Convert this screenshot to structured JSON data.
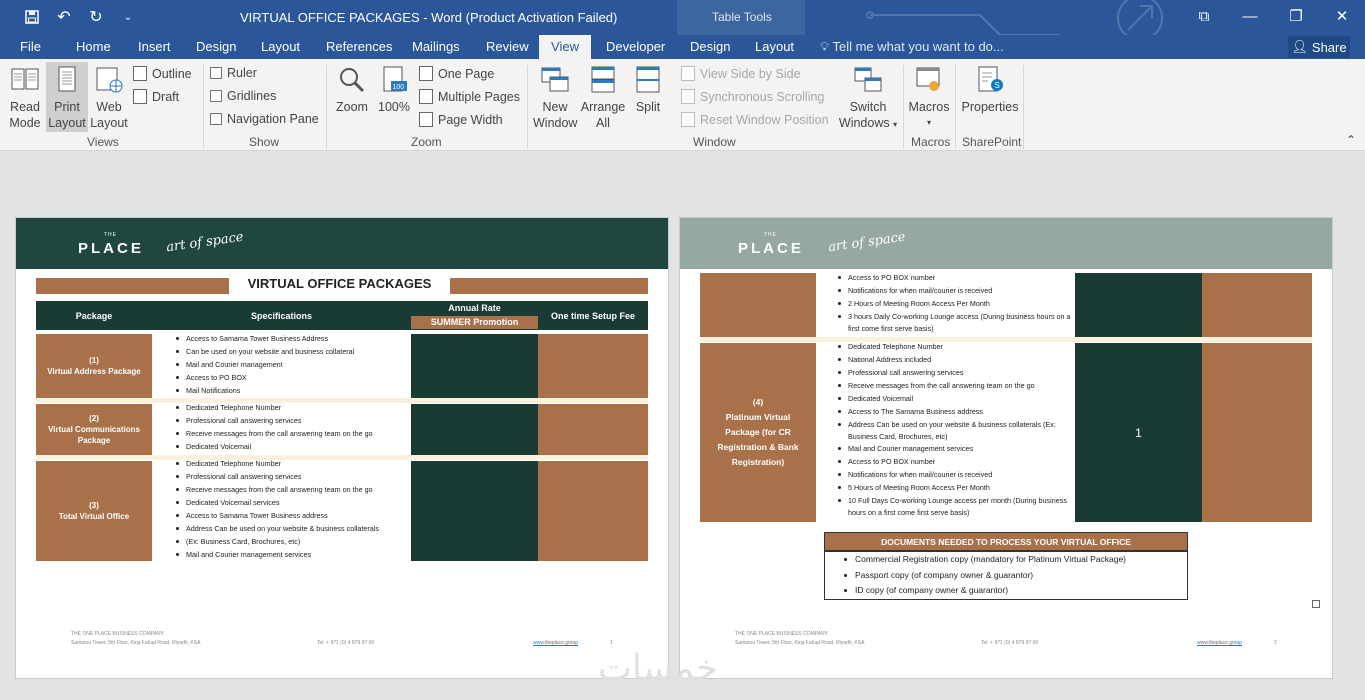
{
  "window": {
    "title": "VIRTUAL OFFICE PACKAGES - Word (Product Activation Failed)",
    "contextual_tab_group": "Table Tools"
  },
  "quick_access": {
    "save_icon": "save-icon",
    "undo_icon": "undo-icon",
    "redo_icon": "redo-icon",
    "customize_icon": "customize-qat-icon"
  },
  "tabs": [
    {
      "label": "File"
    },
    {
      "label": "Home"
    },
    {
      "label": "Insert"
    },
    {
      "label": "Design"
    },
    {
      "label": "Layout"
    },
    {
      "label": "References"
    },
    {
      "label": "Mailings"
    },
    {
      "label": "Review"
    },
    {
      "label": "View",
      "active": true
    },
    {
      "label": "Developer"
    },
    {
      "label": "Design"
    },
    {
      "label": "Layout"
    }
  ],
  "tell_me": "Tell me what you want to do...",
  "share": "Share",
  "ribbon": {
    "views": {
      "read_mode": "Read Mode",
      "print_layout": "Print Layout",
      "web_layout": "Web Layout",
      "outline": "Outline",
      "draft": "Draft",
      "group": "Views",
      "read_1": "Read",
      "read_2": "Mode",
      "print_1": "Print",
      "print_2": "Layout",
      "web_1": "Web",
      "web_2": "Layout"
    },
    "show": {
      "ruler": "Ruler",
      "gridlines": "Gridlines",
      "navigation_pane": "Navigation Pane",
      "group": "Show"
    },
    "zoom": {
      "zoom": "Zoom",
      "hundred": "100%",
      "one_page": "One Page",
      "multiple_pages": "Multiple Pages",
      "page_width": "Page Width",
      "group": "Zoom",
      "hundred_icon_text": "100"
    },
    "window": {
      "new_1": "New",
      "new_2": "Window",
      "arrange_1": "Arrange",
      "arrange_2": "All",
      "split": "Split",
      "view_side_by_side": "View Side by Side",
      "sync_scrolling": "Synchronous Scrolling",
      "reset_position": "Reset Window Position",
      "switch_1": "Switch",
      "switch_2": "Windows",
      "group": "Window"
    },
    "macros": {
      "macros": "Macros",
      "group": "Macros"
    },
    "sharepoint": {
      "properties": "Properties",
      "group": "SharePoint"
    }
  },
  "page1": {
    "logo_the": "THE",
    "logo": "PLACE",
    "tagline": "art of space",
    "title": "VIRTUAL OFFICE PACKAGES",
    "headers": {
      "package": "Package",
      "specifications": "Specifications",
      "annual_rate": "Annual Rate",
      "summer": "SUMMER Promotion",
      "setup": "One time Setup Fee"
    },
    "packages": [
      {
        "num": "(1)",
        "name": "Virtual Address Package",
        "specs": [
          "Access to Samama Tower Business Address",
          "Can be used on your website and business collateral",
          "Mail and Courier management",
          "Access to PO BOX",
          "Mail Notifications"
        ]
      },
      {
        "num": "(2)",
        "name": "Virtual Communications Package",
        "specs": [
          "Dedicated Telephone Number",
          "Professional call answering services",
          "Receive messages from the call answering team on the go",
          "Dedicated Voicemail"
        ]
      },
      {
        "num": "(3)",
        "name": "Total Virtual Office",
        "specs": [
          "Dedicated Telephone Number",
          "Professional call answering services",
          "Receive messages from the call answering team on the go",
          "Dedicated Voicemail services",
          "Access to Samama Tower Business address",
          "Address Can be used on your website & business collaterals",
          "(Ex: Business Card, Brochures, etc)",
          "Mail and Courier management services"
        ]
      }
    ],
    "footer": {
      "company": "THE ONE PLACE BUSINESS COMPANY",
      "address": "Samama Tower, 5th Floor, King Fahad Road, Riyadh, KSA",
      "tel": "Tel: + 971 (0) 4 879 07 00",
      "web": "www.theplace.group",
      "page": "1"
    }
  },
  "page2": {
    "logo_the": "THE",
    "logo": "PLACE",
    "tagline": "art of space",
    "cont_specs": [
      "Access to PO BOX number",
      "Notifications for when mail/courier is received",
      "2 Hours of Meeting Room Access Per Month",
      "3 hours Daily Co-working Lounge access (During business hours on a first come first serve basis)"
    ],
    "package4": {
      "num": "(4)",
      "name": "Platinum Virtual Package (for CR Registration & Bank Registration)",
      "specs": [
        "Dedicated Telephone Number",
        "National Address  included",
        "Professional call answering services",
        "Receive messages from the call answering team on the go",
        "Dedicated Voicemail",
        "Access to The Samama Business address",
        "Address Can be used on your website & business collaterals (Ex: Business Card, Brochures, etc)",
        "Mail and Courier management services",
        "Access to PO BOX number",
        "Notifications for when mail/courier is received",
        "5 Hours of Meeting Room Access Per Month",
        "10 Full Days Co-working Lounge access per month (During business hours on a first come first serve basis)"
      ],
      "rate": "1"
    },
    "documents": {
      "title": "DOCUMENTS NEEDED TO PROCESS YOUR VIRTUAL OFFICE",
      "items": [
        "Commercial Registration copy (mandatory for Platinum Virtual Package)",
        "Passport copy (of company owner & guarantor)",
        "ID copy (of company owner & guarantor)"
      ]
    },
    "footer": {
      "company": "THE ONE PLACE BUSINESS COMPANY",
      "address": "Samama Tower, 5th Floor, King Fahad Road, Riyadh, KSA",
      "tel": "Tel: + 971 (0) 4 879 07 00",
      "web": "www.theplace.group",
      "page": "2"
    }
  },
  "watermark": "خمسات",
  "colors": {
    "word_blue": "#2b579a",
    "brand_green": "#1f4740",
    "brand_brown": "#a8714a",
    "brand_dark": "#1a3a34",
    "page2_band": "#96a8a2"
  }
}
